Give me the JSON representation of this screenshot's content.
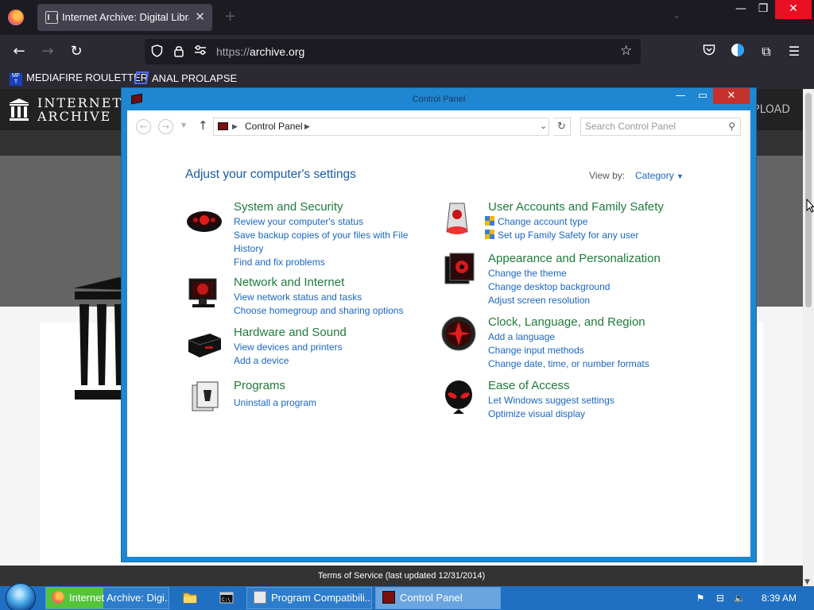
{
  "browser": {
    "tab_title": "Internet Archive: Digital Library of Free & Borrowable Books, Movies, Music & Wayback Machine",
    "tab_close": "✕",
    "new_tab": "+",
    "url_scheme": "https://",
    "url_host": "archive.org",
    "bookmarks": [
      {
        "label": "MEDIAFIRE ROULETTER",
        "icon": "mediafire-icon",
        "icon_text": "MF T"
      },
      {
        "label": "ANAL PROLAPSE",
        "icon": "bookmark-icon"
      }
    ]
  },
  "archive": {
    "logo_line1": "INTERNET",
    "logo_line2": "ARCHIVE",
    "upload_label": "PLOAD",
    "footer": "Terms of Service (last updated 12/31/2014)"
  },
  "control_panel": {
    "window_title": "Control Panel",
    "breadcrumb": "Control Panel",
    "search_placeholder": "Search Control Panel",
    "heading": "Adjust your computer's settings",
    "view_by_label": "View by:",
    "view_by_value": "Category",
    "categories": [
      {
        "title": "System and Security",
        "icon": "system-security-icon",
        "links": [
          "Review your computer's status",
          "Save backup copies of your files with File History",
          "Find and fix problems"
        ]
      },
      {
        "title": "Network and Internet",
        "icon": "network-internet-icon",
        "links": [
          "View network status and tasks",
          "Choose homegroup and sharing options"
        ]
      },
      {
        "title": "Hardware and Sound",
        "icon": "hardware-sound-icon",
        "links": [
          "View devices and printers",
          "Add a device"
        ]
      },
      {
        "title": "Programs",
        "icon": "programs-icon",
        "links": [
          "Uninstall a program"
        ]
      },
      {
        "title": "User Accounts and Family Safety",
        "icon": "user-accounts-icon",
        "links": [
          "Change account type",
          "Set up Family Safety for any user"
        ]
      },
      {
        "title": "Appearance and Personalization",
        "icon": "appearance-icon",
        "links": [
          "Change the theme",
          "Change desktop background",
          "Adjust screen resolution"
        ]
      },
      {
        "title": "Clock, Language, and Region",
        "icon": "clock-region-icon",
        "links": [
          "Add a language",
          "Change input methods",
          "Change date, time, or number formats"
        ]
      },
      {
        "title": "Ease of Access",
        "icon": "ease-of-access-icon",
        "links": [
          "Let Windows suggest settings",
          "Optimize visual display"
        ]
      }
    ]
  },
  "taskbar": {
    "buttons": [
      {
        "label": "Internet Archive: Digi...",
        "icon": "firefox-icon"
      },
      {
        "label": "Program Compatibili...",
        "icon": "program-compat-icon"
      },
      {
        "label": "Control Panel",
        "icon": "control-panel-icon"
      }
    ],
    "clock": "8:39 AM"
  }
}
